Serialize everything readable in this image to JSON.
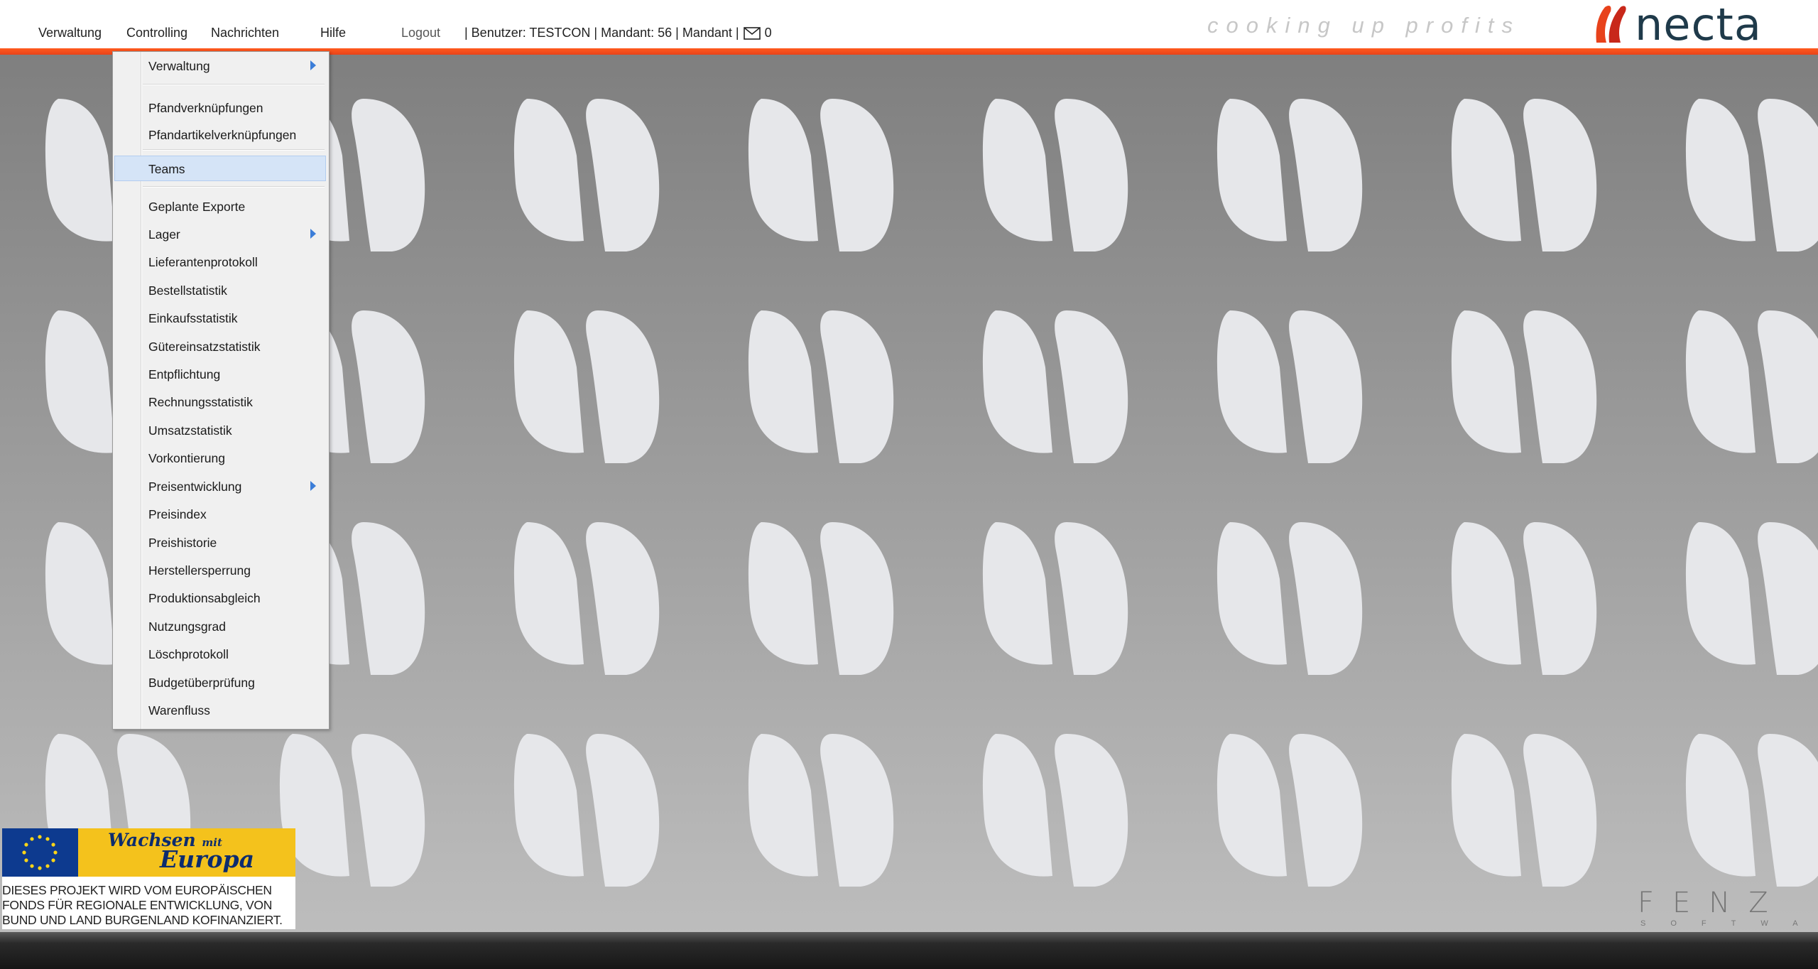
{
  "menubar": {
    "items": [
      "Verwaltung",
      "Controlling",
      "Nachrichten",
      "Hilfe"
    ],
    "logout": "Logout",
    "userinfo": "| Benutzer: TESTCON | Mandant: 56 | Mandant |",
    "message_count": "0"
  },
  "brand": {
    "slogan": "cooking up profits",
    "logo": "necta",
    "accent_color": "#f04e1c",
    "logo_color": "#1f3a4a"
  },
  "dropdown": {
    "items": [
      {
        "label": "Verwaltung",
        "submenu": true
      },
      {
        "label": "Pfandverknüpfungen"
      },
      {
        "label": "Pfandartikelverknüpfungen"
      },
      {
        "label": "Teams",
        "highlighted": true
      },
      {
        "label": "Geplante Exporte"
      },
      {
        "label": "Lager",
        "submenu": true
      },
      {
        "label": "Lieferantenprotokoll"
      },
      {
        "label": "Bestellstatistik"
      },
      {
        "label": "Einkaufsstatistik"
      },
      {
        "label": "Gütereinsatzstatistik"
      },
      {
        "label": "Entpflichtung"
      },
      {
        "label": "Rechnungsstatistik"
      },
      {
        "label": "Umsatzstatistik"
      },
      {
        "label": "Vorkontierung"
      },
      {
        "label": "Preisentwicklung",
        "submenu": true
      },
      {
        "label": "Preisindex"
      },
      {
        "label": "Preishistorie"
      },
      {
        "label": "Herstellersperrung"
      },
      {
        "label": "Produktionsabgleich"
      },
      {
        "label": "Nutzungsgrad"
      },
      {
        "label": "Löschprotokoll"
      },
      {
        "label": "Budgetüberprüfung"
      },
      {
        "label": "Warenfluss"
      }
    ]
  },
  "eu_badge": {
    "slogan_line1": "Wachsen",
    "slogan_mit": "mit",
    "slogan_line2": "Europa",
    "text": "DIESES PROJEKT WIRD VOM EUROPÄISCHEN FONDS FÜR REGIONALE ENTWICKLUNG, VON BUND UND LAND BURGENLAND KOFINANZIERT."
  },
  "footer_brand": {
    "name": "FENZ",
    "sub": "SOFTWARE"
  }
}
